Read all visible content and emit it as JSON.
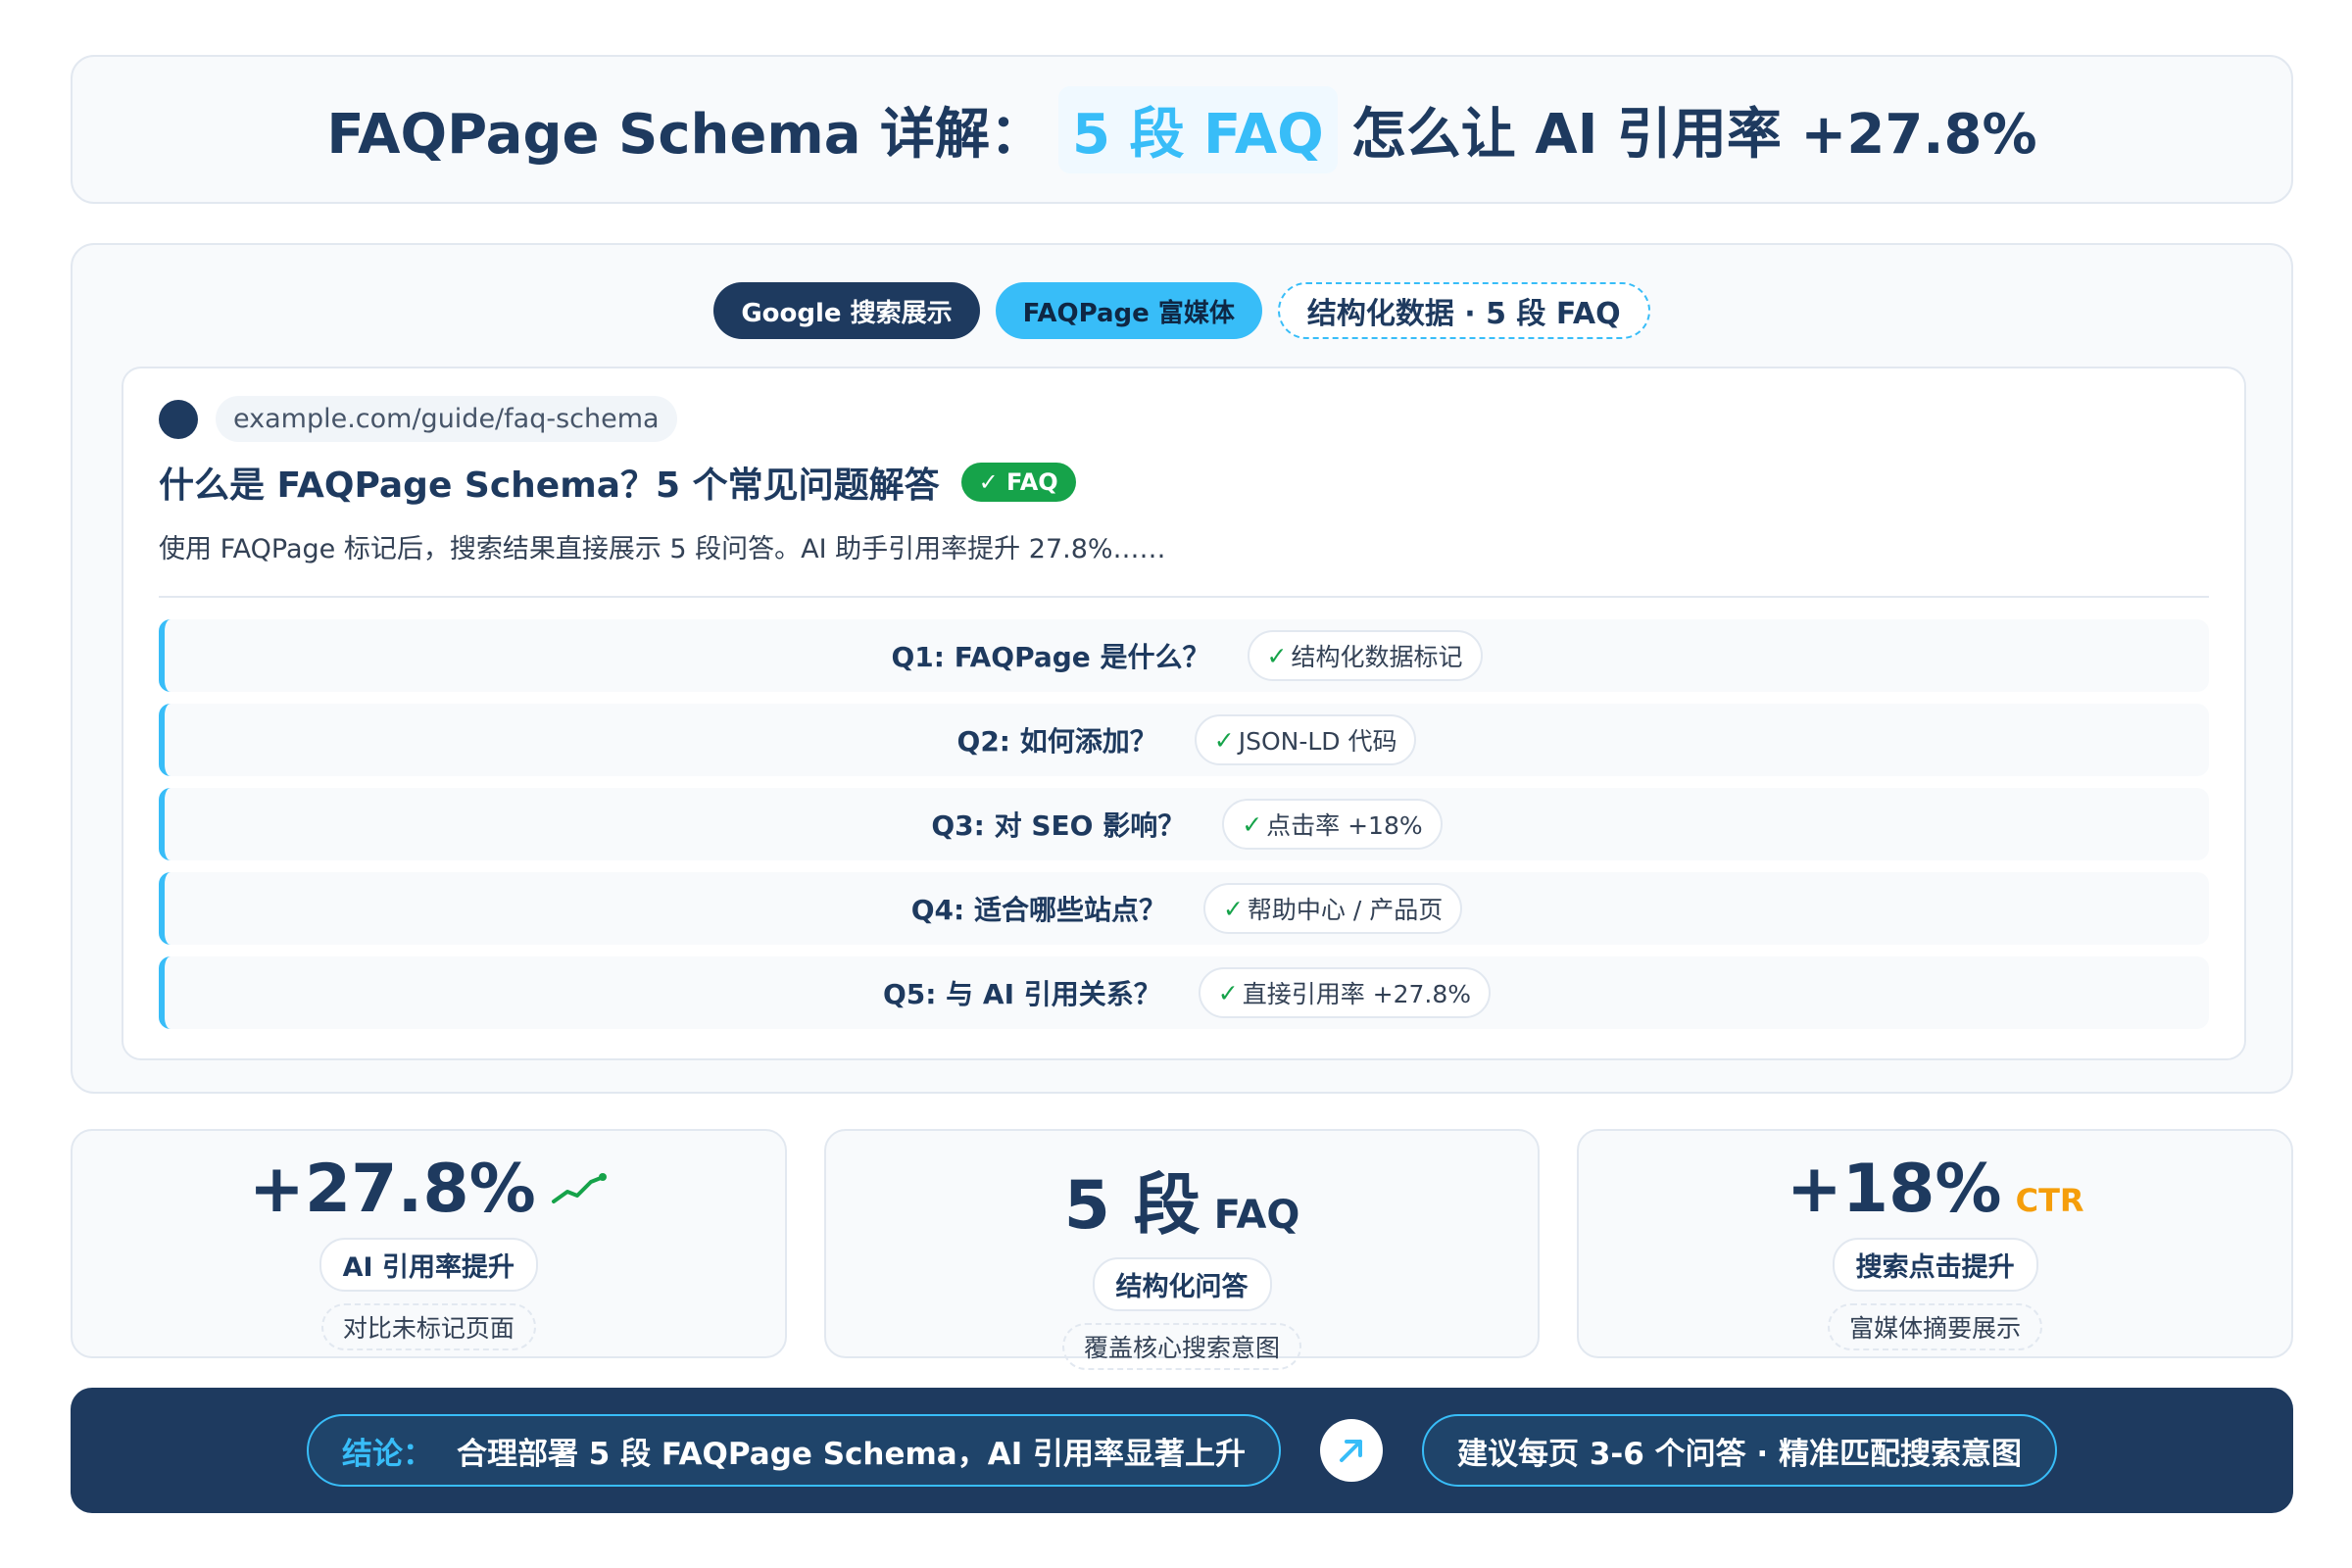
{
  "header": {
    "title_prefix": "FAQPage Schema 详解：",
    "title_highlight": "5 段 FAQ",
    "title_suffix": "怎么让 AI 引用率 +27.8%"
  },
  "tabs": [
    {
      "label": "Google 搜索展示"
    },
    {
      "label": "FAQPage 富媒体"
    },
    {
      "label": "结构化数据 · 5 段 FAQ"
    }
  ],
  "serp": {
    "url": "example.com/guide/faq-schema",
    "title": "什么是 FAQPage Schema？5 个常见问题解答",
    "badge": "✓ FAQ",
    "description": "使用 FAQPage 标记后，搜索结果直接展示 5 段问答。AI 助手引用率提升 27.8%……",
    "faqs": [
      {
        "q": "Q1: FAQPage 是什么？",
        "a": "结构化数据标记"
      },
      {
        "q": "Q2: 如何添加？",
        "a": "JSON-LD 代码"
      },
      {
        "q": "Q3: 对 SEO 影响？",
        "a": "点击率 +18%"
      },
      {
        "q": "Q4: 适合哪些站点？",
        "a": "帮助中心 / 产品页"
      },
      {
        "q": "Q5: 与 AI 引用关系？",
        "a": "直接引用率 +27.8%"
      }
    ]
  },
  "stats": [
    {
      "value": "+27.8%",
      "label": "AI 引用率提升",
      "sub": "对比未标记页面",
      "icon": "trend-up-icon"
    },
    {
      "value": "5 段",
      "unit": "FAQ",
      "label": "结构化问答",
      "sub": "覆盖核心搜索意图"
    },
    {
      "value": "+18%",
      "unit": "CTR",
      "label": "搜索点击提升",
      "sub": "富媒体摘要展示"
    }
  ],
  "conclusion": {
    "lead": "结论：",
    "text": "合理部署 5 段 FAQPage Schema，AI 引用率显著上升",
    "icon": "arrow-up-right-icon",
    "recommendation": "建议每页 3-6 个问答 · 精准匹配搜索意图"
  },
  "colors": {
    "navy": "#1e3a5f",
    "sky": "#38bdf8",
    "green": "#16a34a",
    "orange": "#f59e0b"
  }
}
